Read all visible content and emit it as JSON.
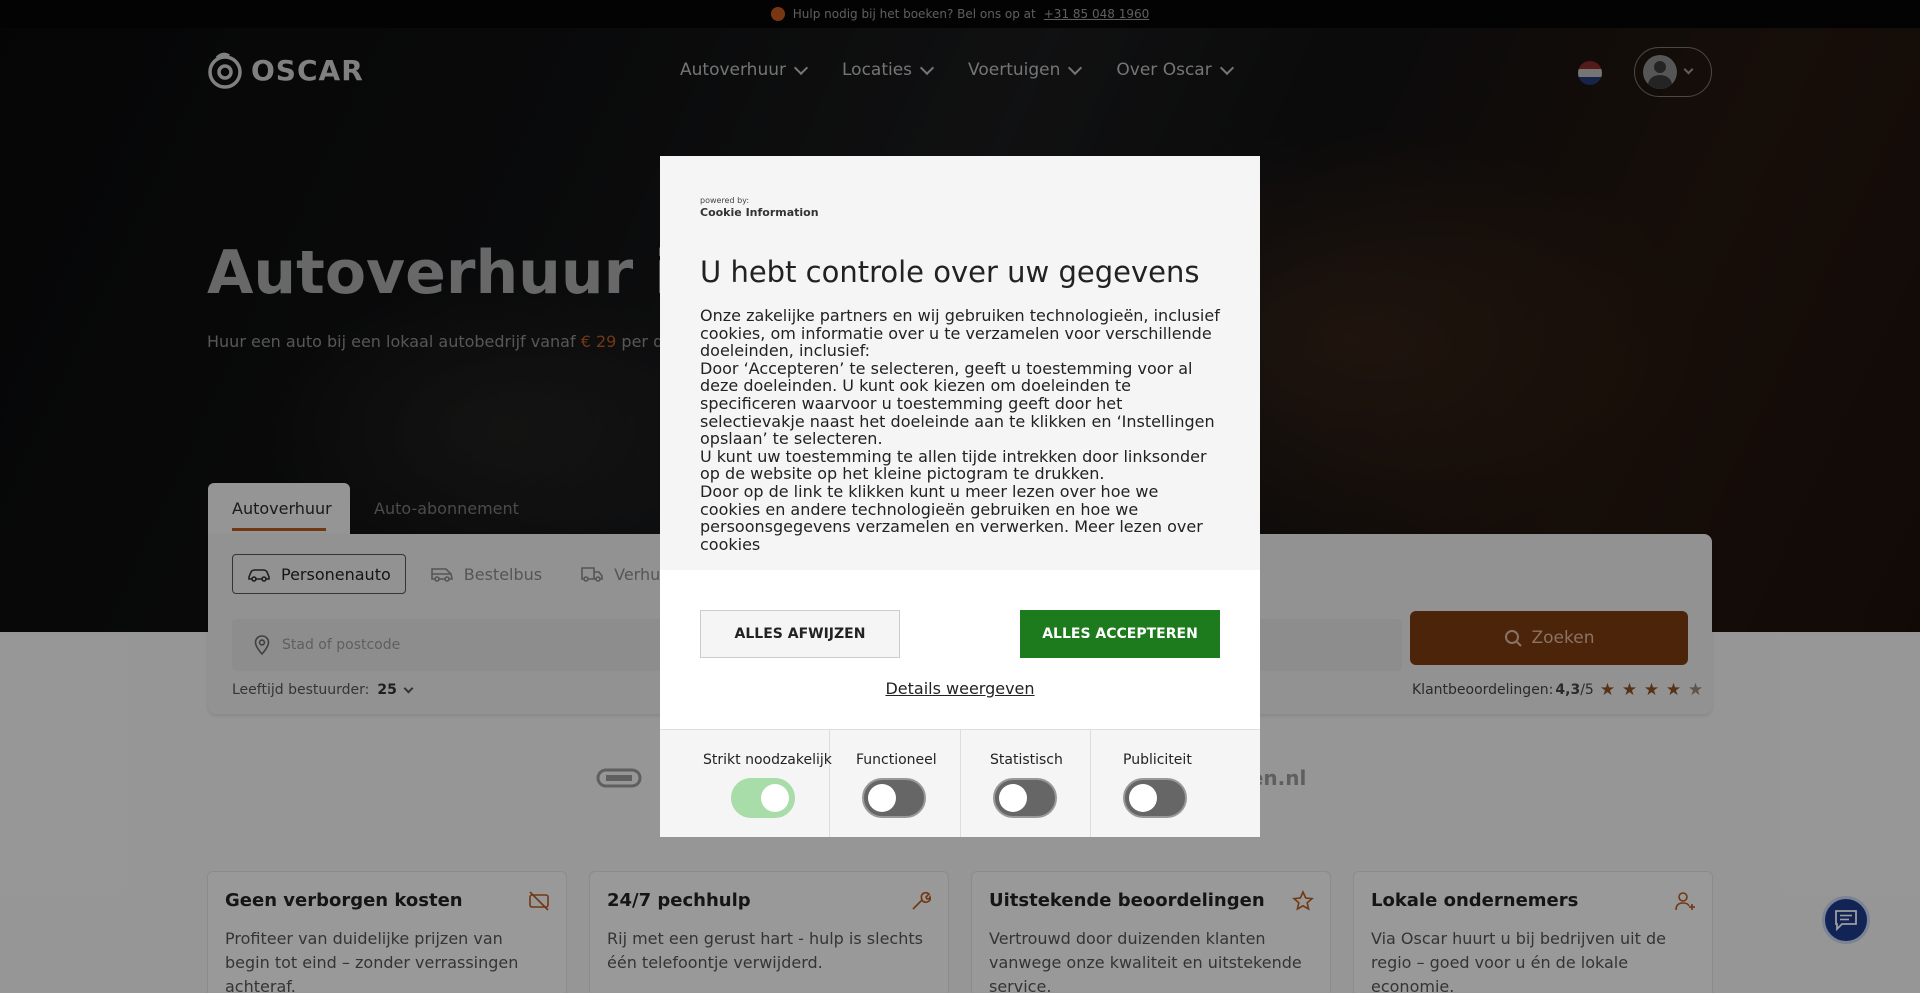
{
  "topbar": {
    "text": "Hulp nodig bij het boeken? Bel ons op at",
    "phone": "+31 85 048 1960"
  },
  "nav": {
    "logo_text": "OSCAR",
    "menu": [
      {
        "label": "Autoverhuur"
      },
      {
        "label": "Locaties"
      },
      {
        "label": "Voertuigen"
      },
      {
        "label": "Over Oscar"
      }
    ]
  },
  "hero": {
    "title": "Autoverhuur in",
    "subtitle_before": "Huur een auto bij een lokaal autobedrijf vanaf",
    "price": "€ 29",
    "subtitle_after": "per dag"
  },
  "search": {
    "tabs": [
      {
        "label": "Autoverhuur"
      },
      {
        "label": "Auto-abonnement"
      }
    ],
    "vehicle_types": [
      {
        "label": "Personenauto",
        "icon": "car-icon"
      },
      {
        "label": "Bestelbus",
        "icon": "van-icon"
      },
      {
        "label": "Verhuis",
        "icon": "truck-icon"
      }
    ],
    "location_placeholder": "Stad of postcode",
    "search_button": "Zoeken",
    "age_label": "Leeftijd bestuurder:",
    "age_value": "25",
    "reviews_label": "Klantbeoordelingen:",
    "reviews_score": "4,3",
    "reviews_max": "/5",
    "reviews_rating": 4.3
  },
  "partners": {
    "right_logo_text": "ren.nl"
  },
  "features": [
    {
      "title": "Geen verborgen kosten",
      "text": "Profiteer van duidelijke prijzen van begin tot eind – zonder verrassingen achteraf.",
      "icon": "no-money-icon"
    },
    {
      "title": "24/7 pechhulp",
      "text": "Rij met een gerust hart - hulp is slechts één telefoontje verwijderd.",
      "icon": "wrench-icon"
    },
    {
      "title": "Uitstekende beoordelingen",
      "text": "Vertrouwd door duizenden klanten vanwege onze kwaliteit en uitstekende service.",
      "icon": "star-icon"
    },
    {
      "title": "Lokale ondernemers",
      "text": "Via Oscar huurt u bij bedrijven uit de regio – goed voor u én de lokale economie.",
      "icon": "user-plus-icon"
    }
  ],
  "cookie_modal": {
    "powered_by": "powered by:",
    "brand": "Cookie Information",
    "title": "U hebt controle over uw gegevens",
    "paragraphs": [
      "Onze zakelijke partners en wij gebruiken technologieën, inclusief cookies, om informatie over u te verzamelen voor verschillende doeleinden, inclusief:",
      "Door ‘Accepteren’ te selecteren, geeft u toestemming voor al deze doeleinden. U kunt ook kiezen om doeleinden te specificeren waarvoor u toestemming geeft door het selectievakje naast het doeleinde aan te klikken en ‘Instellingen opslaan’ te selecteren.",
      "U kunt uw toestemming te allen tijde intrekken door linksonder op de website op het kleine pictogram te drukken.",
      "Door op de link te klikken kunt u meer lezen over hoe we cookies en andere technologieën gebruiken en hoe we persoonsgegevens verzamelen en verwerken. Meer lezen over cookies"
    ],
    "decline_button": "ALLES AFWIJZEN",
    "accept_button": "ALLES ACCEPTEREN",
    "details_link": "Details weergeven",
    "categories": [
      {
        "label": "Strikt noodzakelijk",
        "enabled": true
      },
      {
        "label": "Functioneel",
        "enabled": false
      },
      {
        "label": "Statistisch",
        "enabled": false
      },
      {
        "label": "Publiciteit",
        "enabled": false
      }
    ]
  },
  "colors": {
    "accent": "#b85a1f",
    "accept_green": "#1d7a1d",
    "chat_blue": "#1d3a8a"
  }
}
